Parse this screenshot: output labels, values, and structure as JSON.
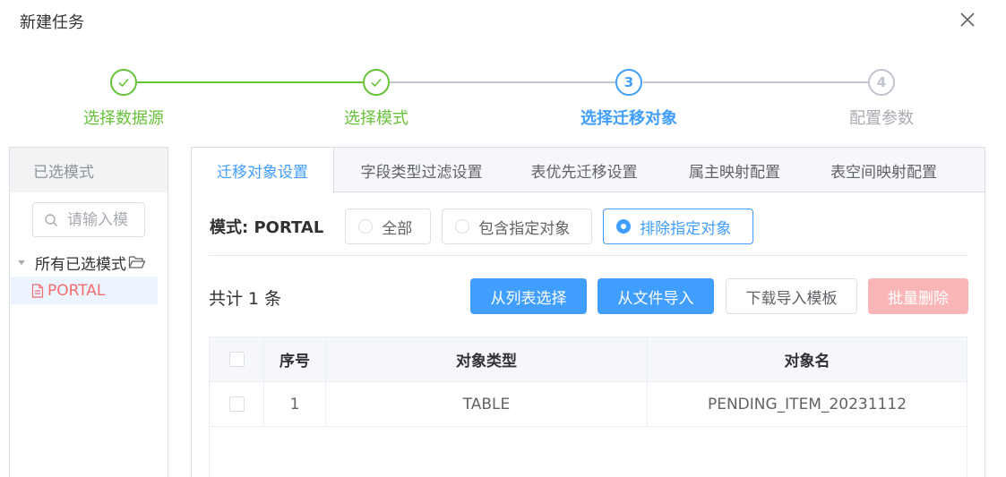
{
  "dialog": {
    "title": "新建任务"
  },
  "steps": [
    {
      "label": "选择数据源",
      "status": "done",
      "number": "1"
    },
    {
      "label": "选择模式",
      "status": "done",
      "number": "2"
    },
    {
      "label": "选择迁移对象",
      "status": "active",
      "number": "3"
    },
    {
      "label": "配置参数",
      "status": "wait",
      "number": "4"
    }
  ],
  "left": {
    "header": "已选模式",
    "search_placeholder": "请输入模",
    "tree_root": "所有已选模式",
    "tree_leaf": "PORTAL"
  },
  "tabs": [
    {
      "label": "迁移对象设置",
      "active": true
    },
    {
      "label": "字段类型过滤设置"
    },
    {
      "label": "表优先迁移设置"
    },
    {
      "label": "属主映射配置"
    },
    {
      "label": "表空间映射配置"
    }
  ],
  "mode": {
    "label": "模式: PORTAL",
    "options": [
      "全部",
      "包含指定对象",
      "排除指定对象"
    ],
    "selected": "排除指定对象"
  },
  "toolbar": {
    "total": "共计 1 条",
    "from_list": "从列表选择",
    "from_file": "从文件导入",
    "download_template": "下载导入模板",
    "batch_delete": "批量删除"
  },
  "table": {
    "headers": [
      "",
      "序号",
      "对象类型",
      "对象名"
    ],
    "rows": [
      {
        "index": "1",
        "type": "TABLE",
        "name": "PENDING_ITEM_20231112"
      }
    ]
  },
  "colors": {
    "primary": "#409eff",
    "success": "#67c23a",
    "danger": "#f56c6c",
    "wait": "#c0c4cc"
  }
}
